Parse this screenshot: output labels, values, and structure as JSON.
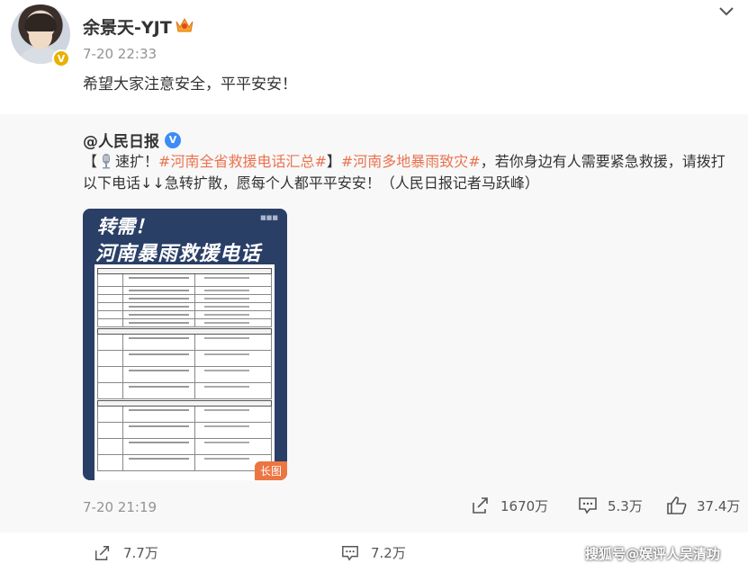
{
  "header": {
    "username": "余景天-YJT",
    "time": "7-20 22:33",
    "text": "希望大家注意安全，平平安安！",
    "avatar_icon": "avatar-photo",
    "verified_icon": "gold-v-badge",
    "member_icon": "crown-icon"
  },
  "repost": {
    "author": "@人民日报",
    "text_prefix": "【",
    "text_speed": "速扩！",
    "topic1": "#河南全省救援电话汇总#",
    "text_mid": "】",
    "topic2": "#河南多地暴雨致灾#",
    "text_rest": "，若你身边有人需要紧急救援，请拨打以下电话↓↓急转扩散，愿每个人都平平安安！（人民日报记者马跃峰）",
    "time": "7-20 21:19",
    "poster": {
      "title1": "转需！",
      "title2": "河南暴雨救援电话",
      "long_image_badge": "长图"
    },
    "stats": {
      "reposts": "1670万",
      "comments": "5.3万",
      "likes": "37.4万"
    }
  },
  "bottom": {
    "reposts": "7.7万",
    "comments": "7.2万",
    "watermark": "搜狐号@娱评人吴清功"
  },
  "colors": {
    "topic": "#eb7350",
    "verified_blue": "#3d8cf5",
    "muted": "#939393",
    "card_bg": "#f8f8f8"
  }
}
